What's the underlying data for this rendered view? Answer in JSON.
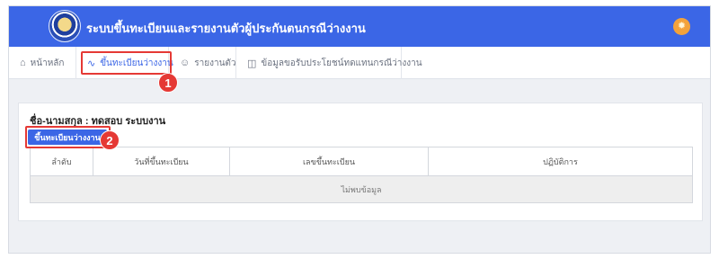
{
  "header": {
    "app_title": "ระบบขึ้นทะเบียนและรายงานตัวผู้ประกันตนกรณีว่างงาน",
    "logo_icon": "department-seal-icon",
    "right_icon": "lightbulb-icon",
    "color": "#3b66e6"
  },
  "nav": {
    "items": [
      {
        "label": "หน้าหลัก",
        "icon": "home-icon"
      },
      {
        "label": "ขึ้นทะเบียนว่างงาน",
        "icon": "activity-icon",
        "active": true
      },
      {
        "label": "รายงานตัว",
        "icon": "user-icon"
      },
      {
        "label": "ข้อมูลขอรับประโยชน์ทดแทนกรณีว่างงาน",
        "icon": "book-icon"
      }
    ]
  },
  "annotations": {
    "step1": "1",
    "step2": "2",
    "color": "#e53935"
  },
  "main": {
    "person_label": "ชื่อ-นามสกุล : ทดสอบ ระบบงาน",
    "register_button": "ขึ้นทะเบียนว่างงาน",
    "table": {
      "headers": [
        "ลำดับ",
        "วันที่ขึ้นทะเบียน",
        "เลขขึ้นทะเบียน",
        "ปฏิบัติการ"
      ],
      "empty_message": "ไม่พบข้อมูล"
    }
  }
}
